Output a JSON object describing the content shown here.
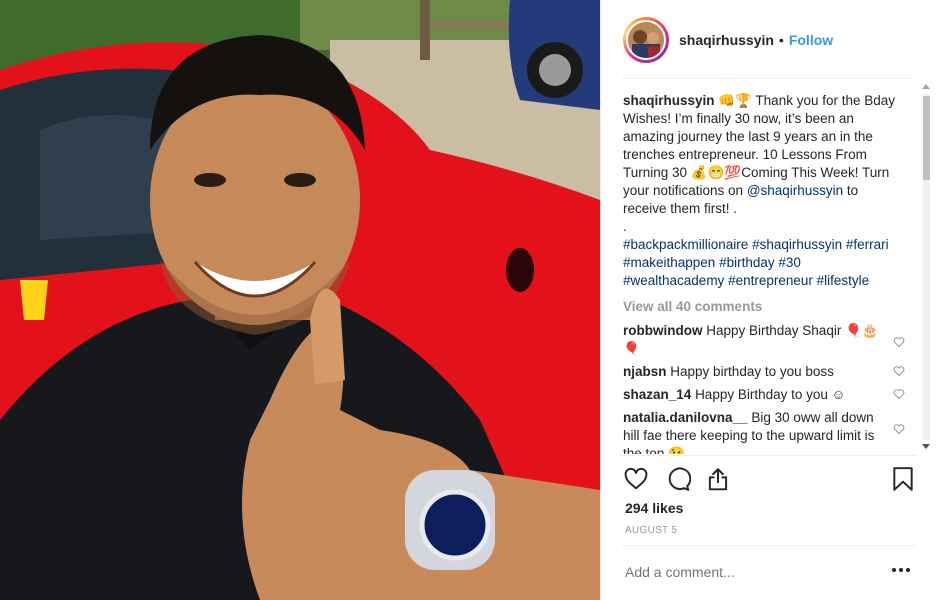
{
  "header": {
    "username": "shaqirhussyin",
    "separator": "•",
    "follow_label": "Follow"
  },
  "caption": {
    "username": "shaqirhussyin",
    "emoji_a": "👊🏆",
    "text_1": " Thank you for the Bday Wishes! I’m finally 30 now, it’s been an amazing journey the last 9 years an in the trenches entrepreneur. 10 Lessons From Turning 30 ",
    "emoji_b": "💰😁💯",
    "text_2": "Coming This Week! Turn your notifications on ",
    "mention": "@shaqirhussyin",
    "text_3": " to receive them first! .",
    "text_4": ".",
    "hashtags": [
      "#backpackmillionaire",
      "#shaqirhussyin",
      "#ferrari",
      "#makeithappen",
      "#birthday",
      "#30",
      "#wealthacademy",
      "#entrepreneur",
      "#lifestyle"
    ]
  },
  "view_all_label": "View all 40 comments",
  "comments": [
    {
      "username": "robbwindow",
      "text": "Happy Birthday Shaqir 🎈🎂🎈"
    },
    {
      "username": "njabsn",
      "text": "Happy birthday to you boss"
    },
    {
      "username": "shazan_14",
      "text": "Happy Birthday to you ☺"
    },
    {
      "username": "natalia.danilovna__",
      "text": "Big 30 oww all down hill fae there keeping to the upward limit is the top 😉"
    }
  ],
  "likes_label": "294 likes",
  "date_label": "AUGUST 5",
  "add_comment_placeholder": "Add a comment...",
  "icons": {
    "like": "heart-icon",
    "comment": "speech-bubble-icon",
    "share": "share-icon",
    "save": "bookmark-icon",
    "options": "more-dots-icon"
  },
  "colors": {
    "follow_blue": "#3897f0",
    "link_navy": "#003569",
    "muted_gray": "#999999",
    "text": "#262626"
  }
}
